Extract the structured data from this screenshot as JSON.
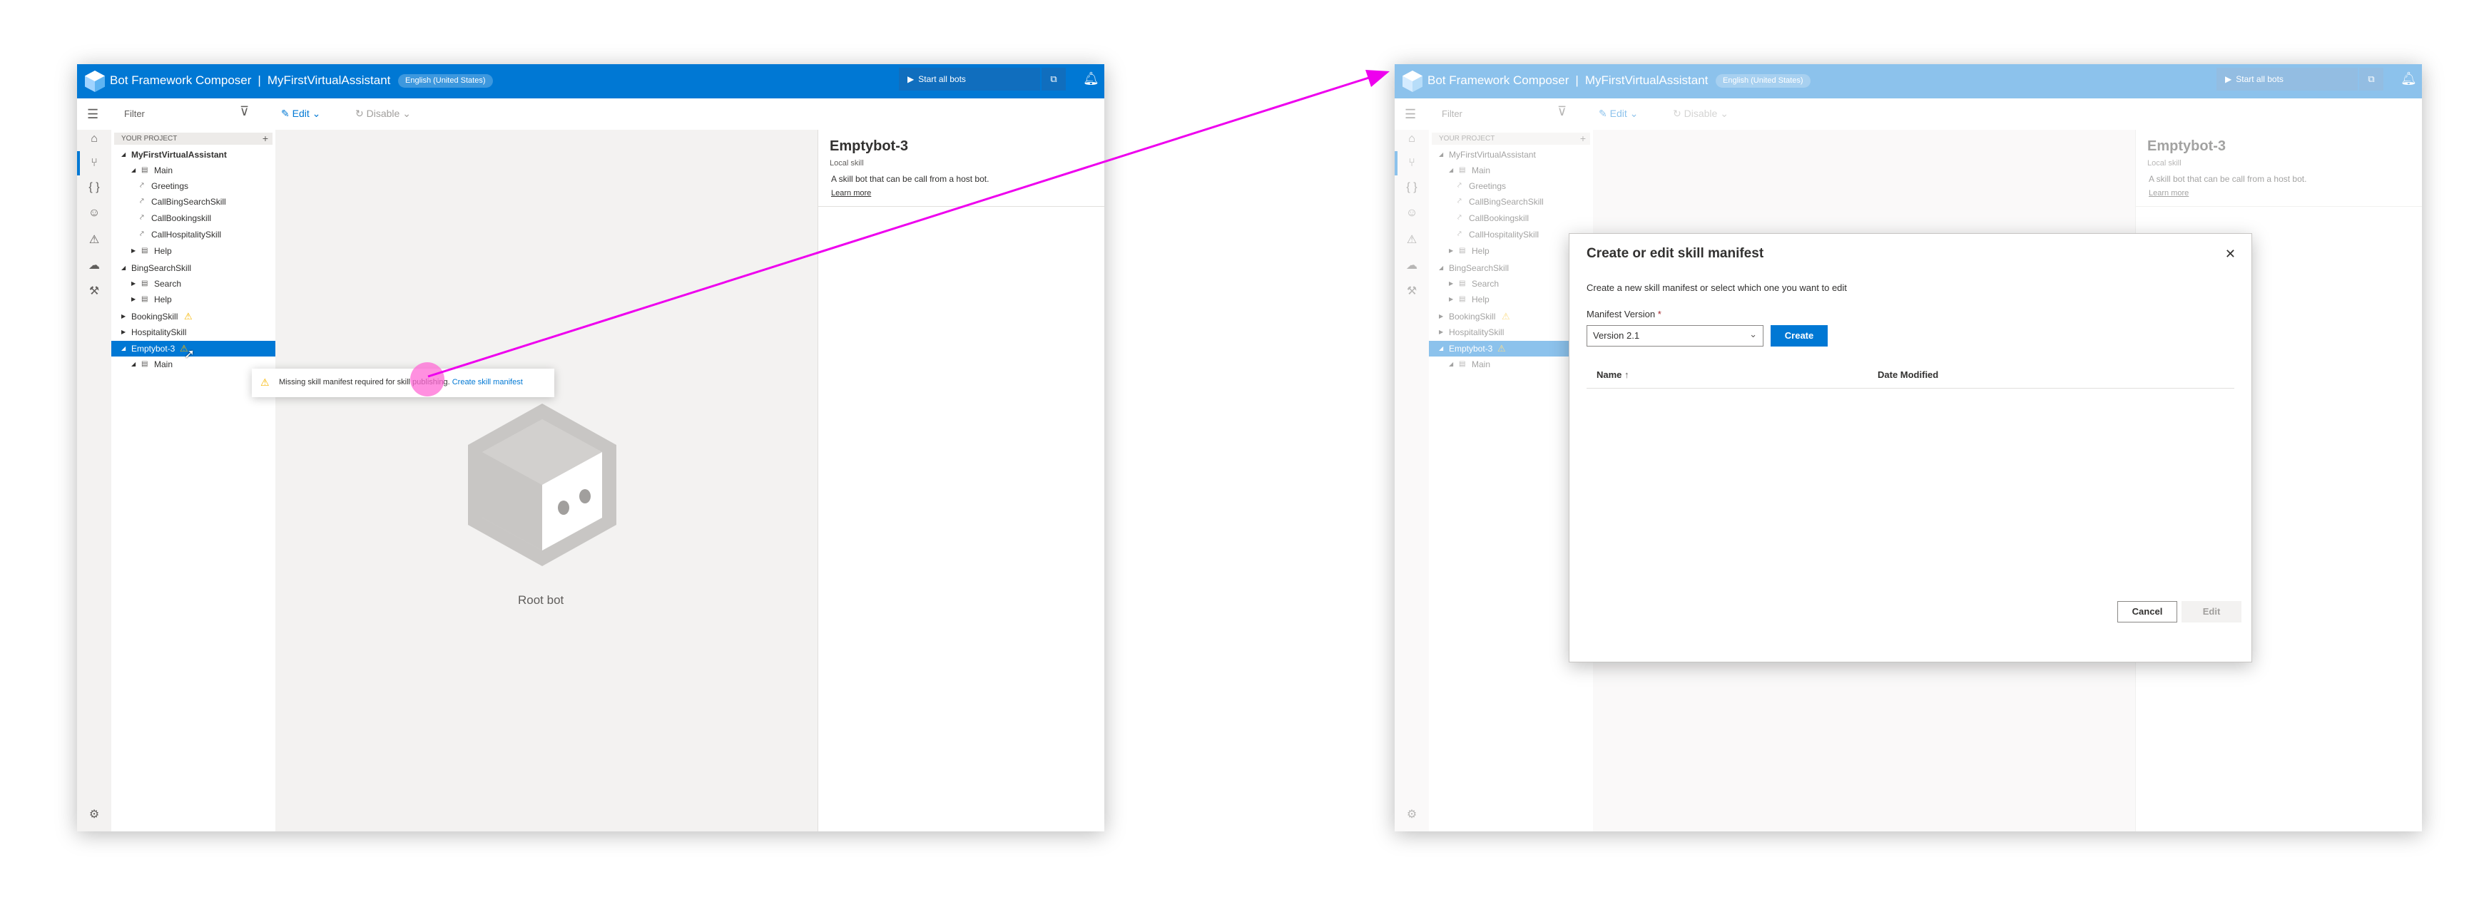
{
  "app": {
    "title": "Bot Framework Composer",
    "separator": "|",
    "project": "MyFirstVirtualAssistant",
    "locale": "English (United States)",
    "start_all_bots": "Start all bots",
    "accent_color": "#0078d4"
  },
  "command_bar": {
    "filter_placeholder": "Filter",
    "edit_label": "Edit",
    "disable_label": "Disable"
  },
  "tree": {
    "header": "YOUR PROJECT",
    "add": "+",
    "items": [
      {
        "label": "MyFirstVirtualAssistant"
      },
      {
        "label": "Main"
      },
      {
        "label": "Greetings"
      },
      {
        "label": "CallBingSearchSkill"
      },
      {
        "label": "CallBookingskill"
      },
      {
        "label": "CallHospitalitySkill"
      },
      {
        "label": "Help"
      },
      {
        "label": "BingSearchSkill"
      },
      {
        "label": "Search"
      },
      {
        "label": "Help"
      },
      {
        "label": "BookingSkill"
      },
      {
        "label": "HospitalitySkill"
      },
      {
        "label": "Emptybot-3"
      },
      {
        "label": "Main"
      }
    ]
  },
  "properties": {
    "title": "Emptybot-3",
    "subtitle": "Local skill",
    "description": "A skill bot that can be call from a host bot.",
    "learn_more": "Learn more"
  },
  "canvas": {
    "root_label": "Root bot"
  },
  "tooltip": {
    "text": "Missing skill manifest required for skill publishing.",
    "link": "Create skill manifest"
  },
  "dialog": {
    "title": "Create or edit skill manifest",
    "subtitle": "Create a new skill manifest or select which one you want to edit",
    "version_label": "Manifest Version",
    "required_mark": "*",
    "version_value": "Version 2.1",
    "create_label": "Create",
    "col_name": "Name",
    "sort_indicator": "↑",
    "col_date": "Date Modified",
    "cancel_label": "Cancel",
    "edit_label": "Edit"
  },
  "icons": {
    "play": "play-icon",
    "bell": "bell-icon",
    "filter": "filter-icon",
    "edit": "pencil-icon",
    "disable": "refresh-icon",
    "warning": "warning-icon",
    "close": "close-icon"
  },
  "colors": {
    "annotation_arrow": "#ee00ee",
    "warning": "#f7b600"
  }
}
